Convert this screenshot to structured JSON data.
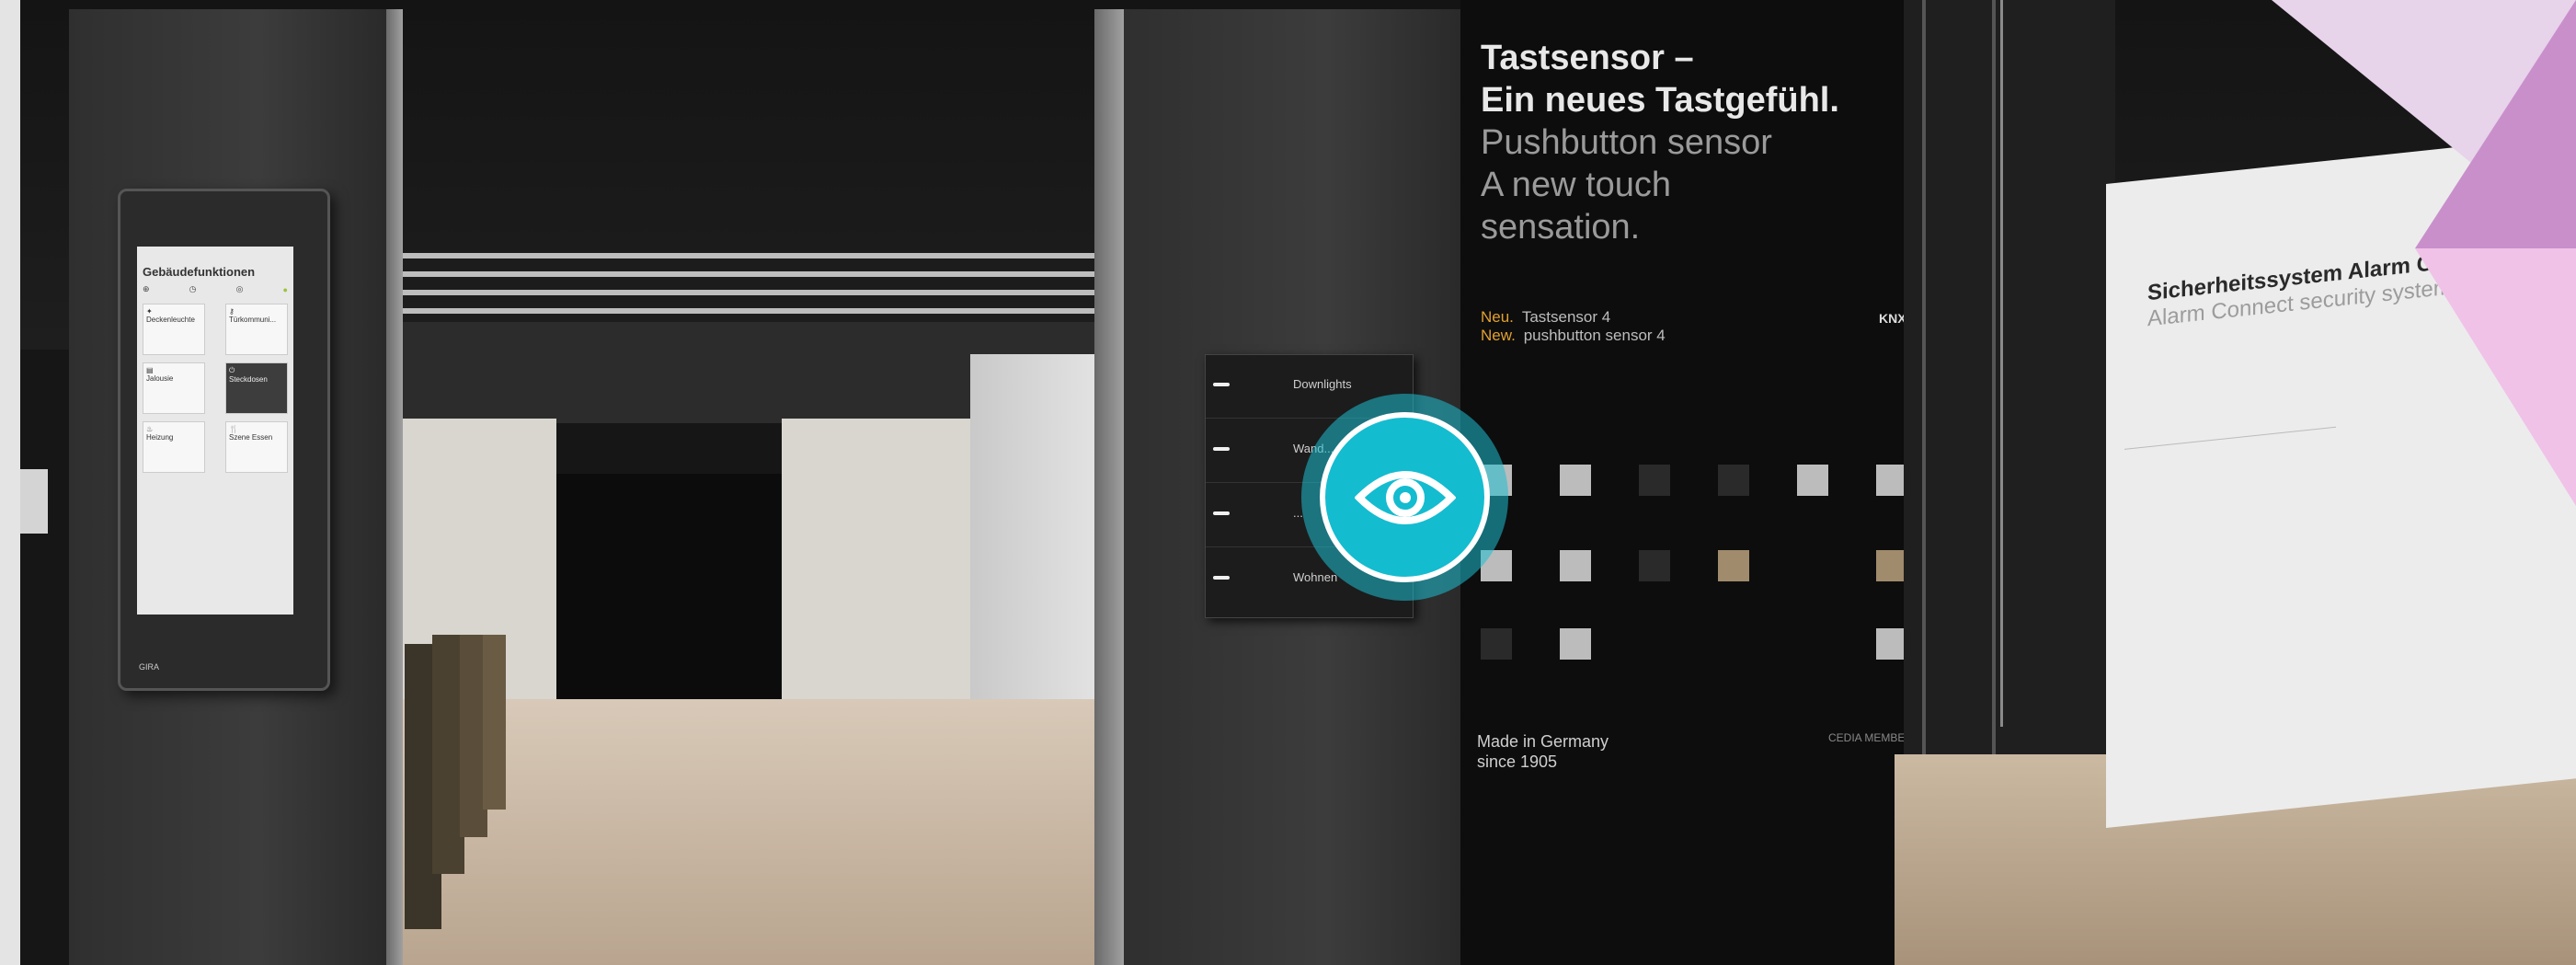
{
  "tablet": {
    "title": "Gebäudefunktionen",
    "tiles": [
      {
        "label": "Deckenleuchte"
      },
      {
        "label": "Türkommuni..."
      },
      {
        "label": "Jalousie"
      },
      {
        "label": "Steckdosen"
      },
      {
        "label": "Heizung"
      },
      {
        "label": "Szene Essen"
      }
    ],
    "brand": "GIRA"
  },
  "switch_panel": {
    "rows": [
      "Downlights",
      "Wand...",
      "...",
      "Wohnen"
    ]
  },
  "info": {
    "title_de_line1": "Tastsensor –",
    "title_de_line2": "Ein neues Tastgefühl.",
    "title_en_line1": "Pushbutton sensor",
    "title_en_line2": "A new touch",
    "title_en_line3": "sensation.",
    "new_de_label": "Neu.",
    "new_de_value": "Tastsensor 4",
    "new_en_label": "New.",
    "new_en_value": "pushbutton sensor 4",
    "knx_logo": "KNX",
    "made_line1": "Made in Germany",
    "made_line2": "since 1905",
    "cedia": "CEDIA MEMBER"
  },
  "security_wall": {
    "title": "Sicherheitssystem Alarm Connect –",
    "subtitle": "Alarm Connect security system – Con"
  },
  "eye_button": {
    "icon": "eye-icon",
    "color": "#14bcd0"
  }
}
